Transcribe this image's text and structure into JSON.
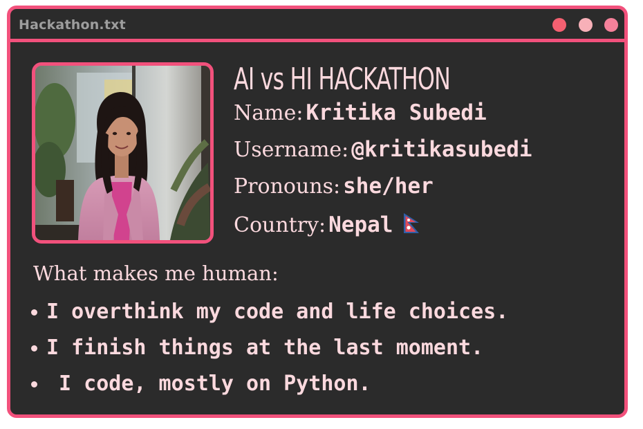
{
  "window": {
    "title": "Hackathon.txt",
    "controls": [
      {
        "name": "close",
        "color": "#f46071"
      },
      {
        "name": "minimize",
        "color": "#f7b0b8"
      },
      {
        "name": "maximize",
        "color": "#f5819a"
      }
    ]
  },
  "profile": {
    "heading": "AI vs HI HACKATHON",
    "fields": [
      {
        "label": "Name:",
        "value": "Kritika Subedi"
      },
      {
        "label": "Username:",
        "value": "@kritikasubedi"
      },
      {
        "label": "Pronouns:",
        "value": "she/her"
      },
      {
        "label": "Country:",
        "value": "Nepal"
      }
    ],
    "country_flag_icon": "nepal-flag-icon"
  },
  "human_section": {
    "title": "What makes me human:",
    "items": [
      "I overthink my code and life choices.",
      "I finish things at the last moment.",
      " I code, mostly on Python."
    ]
  },
  "colors": {
    "accent": "#f2517c",
    "background": "#2b2b2b",
    "text": "#fbd9de",
    "title_text": "#9e9e9e"
  }
}
